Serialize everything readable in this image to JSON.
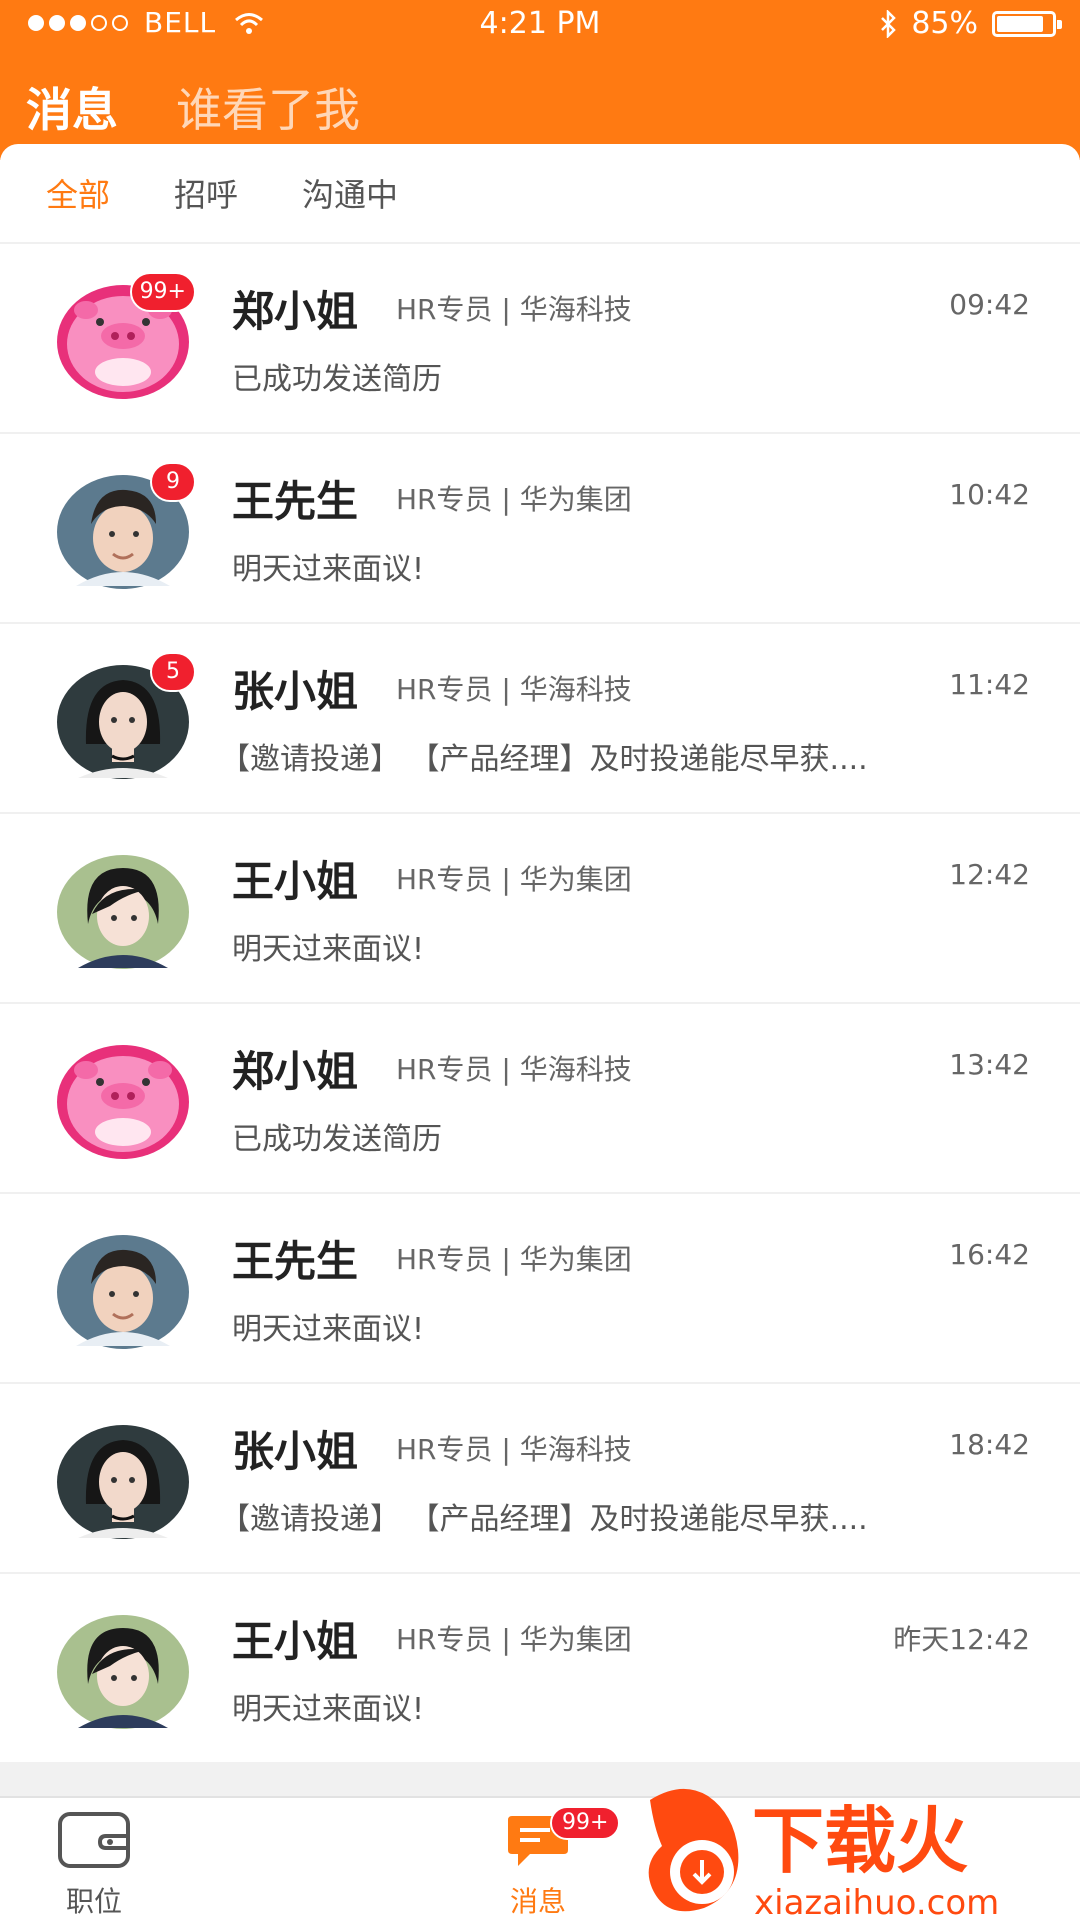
{
  "status_bar": {
    "carrier": "BELL",
    "time": "4:21 PM",
    "battery": "85%"
  },
  "header": {
    "tabs": [
      {
        "label": "消息",
        "active": true
      },
      {
        "label": "谁看了我",
        "active": false
      }
    ]
  },
  "filter_tabs": [
    {
      "label": "全部",
      "active": true
    },
    {
      "label": "招呼",
      "active": false
    },
    {
      "label": "沟通中",
      "active": false
    }
  ],
  "messages": [
    {
      "name": "郑小姐",
      "meta": "HR专员 | 华海科技",
      "time": "09:42",
      "preview": "已成功发送简历",
      "badge": "99+",
      "avatar": "pig-avatar"
    },
    {
      "name": "王先生",
      "meta": "HR专员 | 华为集团",
      "time": "10:42",
      "preview": "明天过来面议!",
      "badge": "9",
      "avatar": "man-avatar"
    },
    {
      "name": "张小姐",
      "meta": "HR专员 | 华海科技",
      "time": "11:42",
      "preview": "【邀请投递】 【产品经理】及时投递能尽早获....",
      "badge": "5",
      "avatar": "woman-dark-avatar"
    },
    {
      "name": "王小姐",
      "meta": "HR专员 | 华为集团",
      "time": "12:42",
      "preview": "明天过来面议!",
      "badge": "",
      "avatar": "woman-short-hair-avatar"
    },
    {
      "name": "郑小姐",
      "meta": "HR专员 | 华海科技",
      "time": "13:42",
      "preview": "已成功发送简历",
      "badge": "",
      "avatar": "pig-avatar"
    },
    {
      "name": "王先生",
      "meta": "HR专员 | 华为集团",
      "time": "16:42",
      "preview": "明天过来面议!",
      "badge": "",
      "avatar": "man-avatar"
    },
    {
      "name": "张小姐",
      "meta": "HR专员 | 华海科技",
      "time": "18:42",
      "preview": "【邀请投递】 【产品经理】及时投递能尽早获....",
      "badge": "",
      "avatar": "woman-dark-avatar"
    },
    {
      "name": "王小姐",
      "meta": "HR专员 | 华为集团",
      "time": "昨天12:42",
      "preview": "明天过来面议!",
      "badge": "",
      "avatar": "woman-short-hair-avatar"
    }
  ],
  "bottom_nav": {
    "jobs_label": "职位",
    "messages_label": "消息",
    "messages_badge": "99+"
  },
  "watermark": {
    "brand": "下载火",
    "url": "xiazaihuo.com"
  },
  "colors": {
    "accent": "#FF7A12",
    "badge": "#F0202E"
  }
}
